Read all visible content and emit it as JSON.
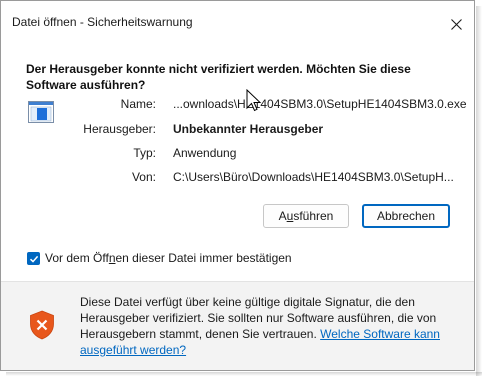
{
  "window": {
    "title": "Datei öffnen - Sicherheitswarnung",
    "close_label": "✕"
  },
  "heading": "Der Herausgeber konnte nicht verifiziert werden. Möchten Sie diese Software ausführen?",
  "details": [
    {
      "label": "Name:",
      "value": "...ownloads\\HE1404SBM3.0\\SetupHE1404SBM3.0.exe",
      "bold": false
    },
    {
      "label": "Herausgeber:",
      "value": "Unbekannter Herausgeber",
      "bold": true
    },
    {
      "label": "Typ:",
      "value": "Anwendung",
      "bold": false
    },
    {
      "label": "Von:",
      "value": "C:\\Users\\Büro\\Downloads\\HE1404SBM3.0\\SetupH...",
      "bold": false
    }
  ],
  "buttons": {
    "run_pre": "A",
    "run_accel": "u",
    "run_post": "sführen",
    "cancel": "Abbrechen"
  },
  "checkbox": {
    "checked": true,
    "label_pre": "Vor dem Öff",
    "label_accel": "n",
    "label_post": "en dieser Datei immer bestätigen"
  },
  "warning": {
    "text": "Diese Datei verfügt über keine gültige digitale Signatur, die den Herausgeber verifiziert. Sie sollten nur Software ausführen, die von Herausgebern stammt, denen Sie vertrauen. ",
    "link": "Welche Software kann ausgeführt werden?"
  },
  "colors": {
    "accent": "#0067c0",
    "shield": "#e8571c"
  },
  "icons": {
    "file": "application-file-icon",
    "shield": "shield-warning-icon",
    "close": "close-icon",
    "check": "checkmark-icon"
  }
}
